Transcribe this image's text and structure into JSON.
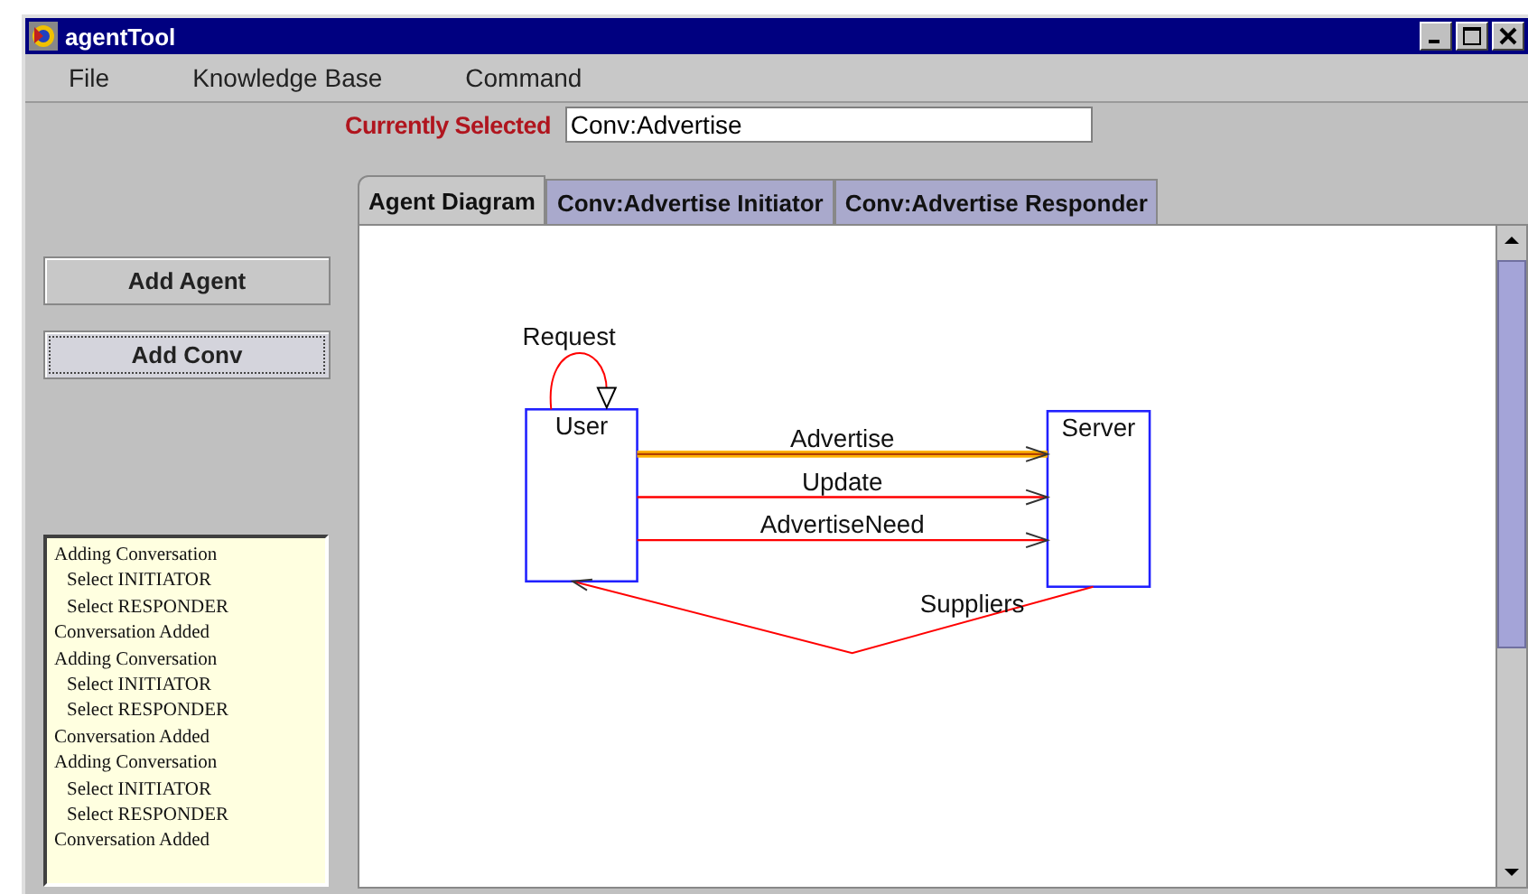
{
  "window": {
    "title": "agentTool"
  },
  "menu": [
    "File",
    "Knowledge Base",
    "Command"
  ],
  "selection": {
    "label": "Currently Selected",
    "value": "Conv:Advertise"
  },
  "tabs": [
    {
      "label": "Agent Diagram",
      "selected": true
    },
    {
      "label": "Conv:Advertise Initiator",
      "selected": false
    },
    {
      "label": "Conv:Advertise Responder",
      "selected": false
    }
  ],
  "buttons": [
    {
      "label": "Add Agent",
      "focused": false
    },
    {
      "label": "Add Conv",
      "focused": true
    }
  ],
  "log": [
    {
      "text": "Adding Conversation",
      "kind": "event"
    },
    {
      "text": "Select INITIATOR",
      "kind": "step"
    },
    {
      "text": "Select RESPONDER",
      "kind": "step"
    },
    {
      "text": "Conversation Added",
      "kind": "event"
    },
    {
      "text": "Adding Conversation",
      "kind": "event"
    },
    {
      "text": "Select INITIATOR",
      "kind": "step"
    },
    {
      "text": "Select RESPONDER",
      "kind": "step"
    },
    {
      "text": "Conversation Added",
      "kind": "event"
    },
    {
      "text": "Adding Conversation",
      "kind": "event"
    },
    {
      "text": "Select INITIATOR",
      "kind": "step"
    },
    {
      "text": "Select RESPONDER",
      "kind": "step"
    },
    {
      "text": "Conversation Added",
      "kind": "event"
    }
  ],
  "diagram": {
    "agents": [
      {
        "name": "User"
      },
      {
        "name": "Server"
      }
    ],
    "conversations": [
      {
        "label": "Request",
        "kind": "self",
        "selected": false
      },
      {
        "label": "Advertise",
        "kind": "forward",
        "selected": true
      },
      {
        "label": "Update",
        "kind": "forward",
        "selected": false
      },
      {
        "label": "AdvertiseNeed",
        "kind": "forward",
        "selected": false
      },
      {
        "label": "Suppliers",
        "kind": "back",
        "selected": false
      }
    ]
  }
}
